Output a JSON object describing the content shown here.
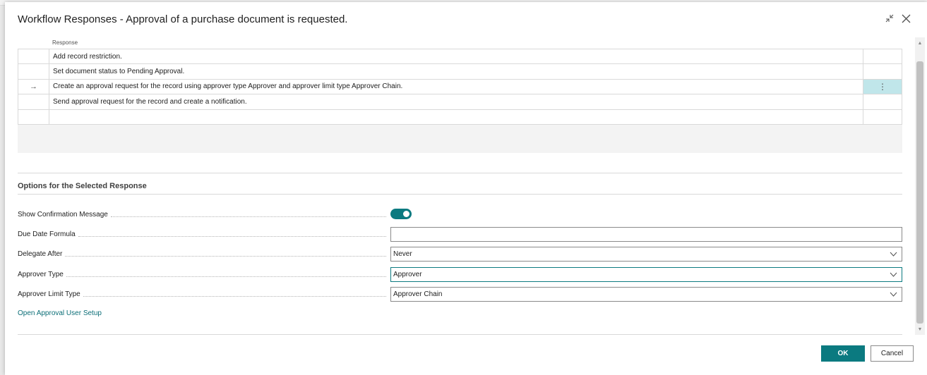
{
  "dialog": {
    "title": "Workflow Responses - Approval of a purchase document is requested."
  },
  "grid": {
    "column_header": "Response",
    "rows": [
      {
        "indicator": "",
        "text": "Add record restriction.",
        "selected": false
      },
      {
        "indicator": "",
        "text": "Set document status to Pending Approval.",
        "selected": false
      },
      {
        "indicator": "→",
        "text": "Create an approval request for the record using approver type Approver and approver limit type Approver Chain.",
        "selected": true,
        "menu": "⋮"
      },
      {
        "indicator": "",
        "text": "Send approval request for the record and create a notification.",
        "selected": false
      },
      {
        "indicator": "",
        "text": "",
        "selected": false
      }
    ]
  },
  "options": {
    "section_title": "Options for the Selected Response",
    "show_confirmation_label": "Show Confirmation Message",
    "show_confirmation_value": true,
    "due_date_label": "Due Date Formula",
    "due_date_value": "",
    "delegate_after_label": "Delegate After",
    "delegate_after_value": "Never",
    "approver_type_label": "Approver Type",
    "approver_type_value": "Approver",
    "approver_limit_label": "Approver Limit Type",
    "approver_limit_value": "Approver Chain",
    "link_label": "Open Approval User Setup"
  },
  "footer": {
    "ok_label": "OK",
    "cancel_label": "Cancel"
  },
  "colors": {
    "accent": "#0b7a80",
    "selected_row": "#c0e6ea",
    "link": "#0b6e77"
  },
  "icons": {
    "collapse": "collapse-icon",
    "close": "close-icon",
    "dropdown": "chevron-down-icon"
  }
}
